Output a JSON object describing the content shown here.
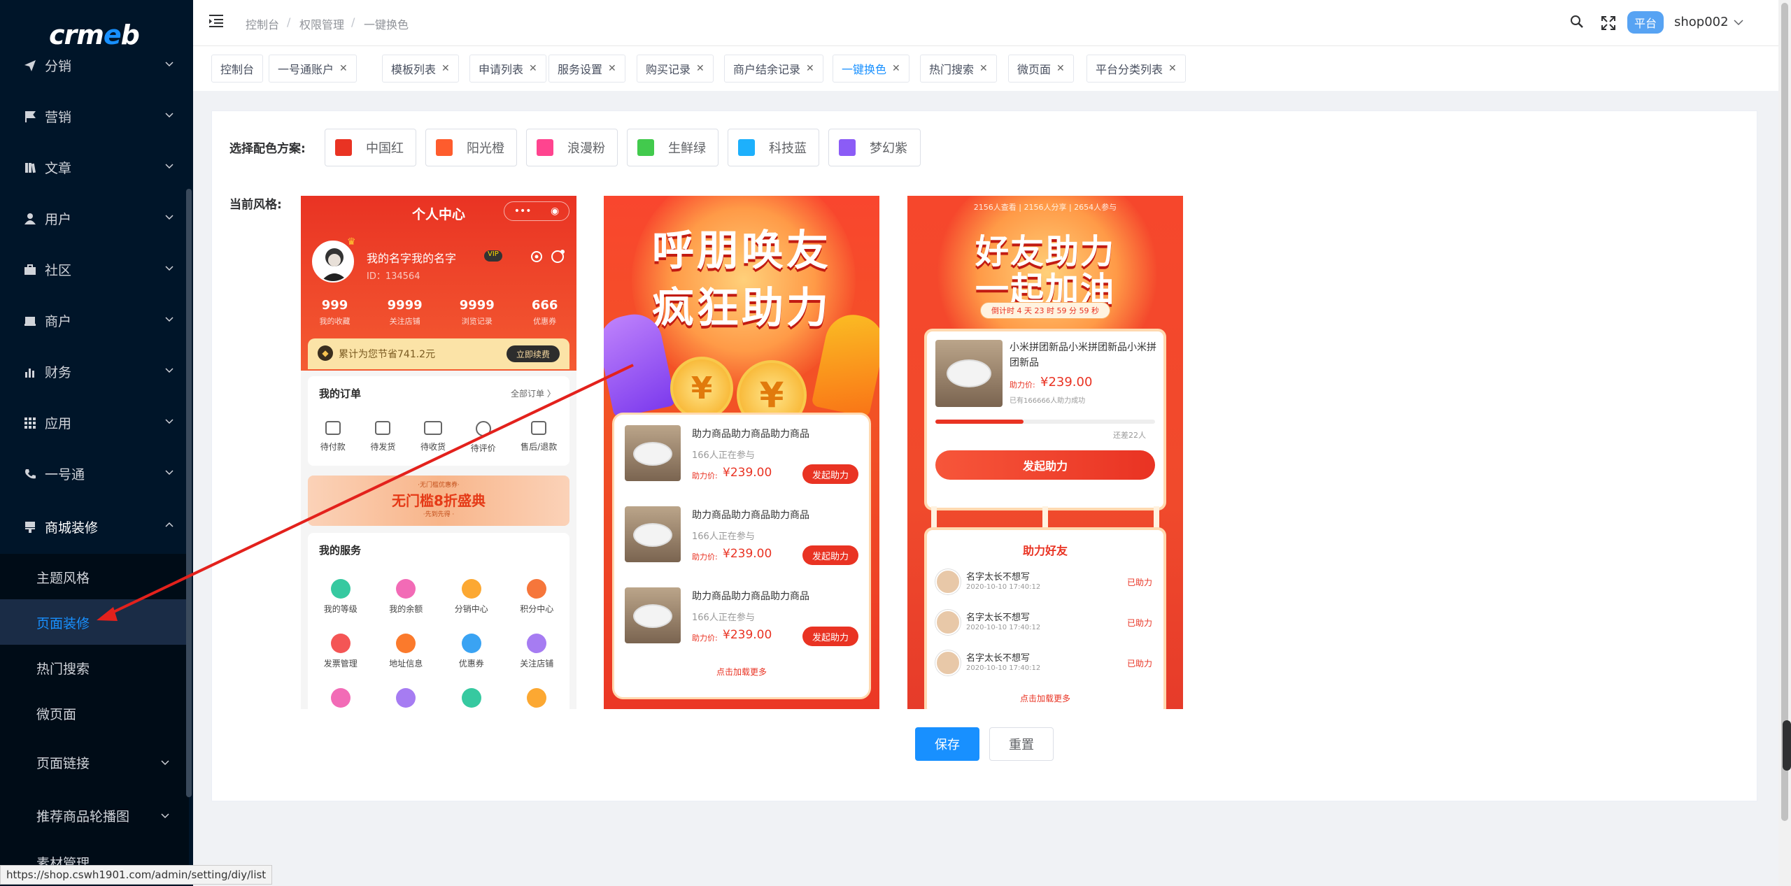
{
  "sidebar": {
    "logo": "crmeb",
    "items": [
      {
        "label": "分销",
        "icon": "send-icon"
      },
      {
        "label": "营销",
        "icon": "flag-icon"
      },
      {
        "label": "文章",
        "icon": "book-icon"
      },
      {
        "label": "用户",
        "icon": "user-icon"
      },
      {
        "label": "社区",
        "icon": "briefcase-icon"
      },
      {
        "label": "商户",
        "icon": "store-icon"
      },
      {
        "label": "财务",
        "icon": "bar-chart-icon"
      },
      {
        "label": "应用",
        "icon": "grid-icon"
      },
      {
        "label": "一号通",
        "icon": "phone-icon"
      },
      {
        "label": "商城装修",
        "icon": "brush-icon"
      }
    ],
    "subitems": [
      "主题风格",
      "页面装修",
      "热门搜索",
      "微页面"
    ],
    "more_items": [
      "页面链接",
      "推荐商品轮播图",
      "素材管理"
    ],
    "active_sub": "页面装修"
  },
  "topbar": {
    "breadcrumb": [
      "控制台",
      "权限管理",
      "一键换色"
    ],
    "separator": "/",
    "platform_badge": "平台",
    "username": "shop002"
  },
  "tags": [
    {
      "label": "控制台",
      "closable": false
    },
    {
      "label": "一号通账户",
      "closable": true
    },
    {
      "label": "模板列表",
      "closable": true
    },
    {
      "label": "申请列表",
      "closable": true
    },
    {
      "label": "服务设置",
      "closable": true
    },
    {
      "label": "购买记录",
      "closable": true
    },
    {
      "label": "商户结余记录",
      "closable": true
    },
    {
      "label": "一键换色",
      "closable": true,
      "active": true
    },
    {
      "label": "热门搜索",
      "closable": true
    },
    {
      "label": "微页面",
      "closable": true
    },
    {
      "label": "平台分类列表",
      "closable": true
    }
  ],
  "main": {
    "color_label": "选择配色方案:",
    "style_label": "当前风格:",
    "color_options": [
      {
        "label": "中国红",
        "color": "#e93323"
      },
      {
        "label": "阳光橙",
        "color": "#fe5c2d"
      },
      {
        "label": "浪漫粉",
        "color": "#ff448f"
      },
      {
        "label": "生鲜绿",
        "color": "#42ca4d"
      },
      {
        "label": "科技蓝",
        "color": "#1db0fc"
      },
      {
        "label": "梦幻紫",
        "color": "#8b5cf6"
      }
    ],
    "save_label": "保存",
    "reset_label": "重置"
  },
  "phone1": {
    "header": "个人中心",
    "username": "我的名字我的名字",
    "vip": "VIP",
    "id": "ID：134564",
    "stats": [
      {
        "value": "999",
        "label": "我的收藏"
      },
      {
        "value": "9999",
        "label": "关注店铺"
      },
      {
        "value": "9999",
        "label": "浏览记录"
      },
      {
        "value": "666",
        "label": "优惠券"
      }
    ],
    "saving": "累计为您节省741.2元",
    "renew": "立即续费",
    "orders_title": "我的订单",
    "orders_all": "全部订单 〉",
    "orders": [
      "待付款",
      "待发货",
      "待收货",
      "待评价",
      "售后/退款"
    ],
    "banner_top": "·无门槛优惠券·",
    "banner": "无门槛8折盛典",
    "banner_sub": "·先到先得 ·",
    "services_title": "我的服务",
    "services": [
      "我的等级",
      "我的余额",
      "分销中心",
      "积分中心",
      "发票管理",
      "地址信息",
      "优惠券",
      "关注店铺"
    ]
  },
  "phone2": {
    "title1": "呼朋唤友",
    "title2": "疯狂助力",
    "items": [
      {
        "name": "助力商品助力商品助力商品",
        "count": "166人正在参与",
        "price_label": "助力价:",
        "price": "¥239.00",
        "button": "发起助力"
      },
      {
        "name": "助力商品助力商品助力商品",
        "count": "166人正在参与",
        "price_label": "助力价:",
        "price": "¥239.00",
        "button": "发起助力"
      },
      {
        "name": "助力商品助力商品助力商品",
        "count": "166人正在参与",
        "price_label": "助力价:",
        "price": "¥239.00",
        "button": "发起助力"
      }
    ],
    "load_more": "点击加载更多"
  },
  "phone3": {
    "stats": "2156人查看 | 2156人分享 | 2654人参与",
    "title1": "好友助力",
    "title2": "一起加油",
    "countdown": "倒计时 4 天 23 时 59 分 59 秒",
    "product": "小米拼团新品小米拼团新品小米拼团新品",
    "price_label": "助力价:",
    "price": "¥239.00",
    "success": "已有166666人助力成功",
    "progress_ratio": 0.4,
    "remaining": "还差22人",
    "button": "发起助力",
    "friends_title": "助力好友",
    "friends": [
      {
        "name": "名字太长不想写",
        "time": "2020-10-10 17:40:12",
        "status": "已助力"
      },
      {
        "name": "名字太长不想写",
        "time": "2020-10-10 17:40:12",
        "status": "已助力"
      },
      {
        "name": "名字太长不想写",
        "time": "2020-10-10 17:40:12",
        "status": "已助力"
      }
    ],
    "load_more": "点击加载更多"
  },
  "status_url": "https://shop.cswh1901.com/admin/setting/diy/list"
}
